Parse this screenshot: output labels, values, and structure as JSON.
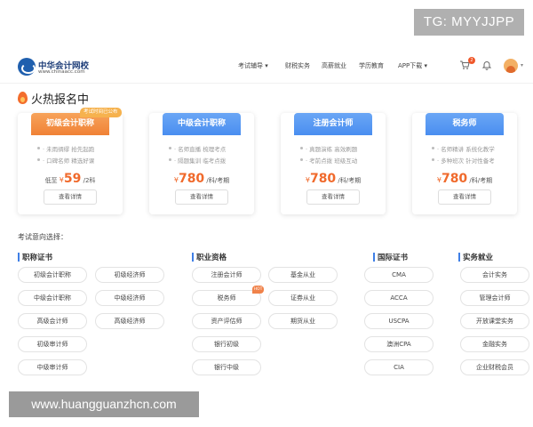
{
  "overlay": {
    "tg": "TG: MYYJJPP",
    "site": "www.huangguanzhcn.com"
  },
  "header": {
    "logo_name": "中华会计网校",
    "logo_url": "www.chinaacc.com",
    "nav": [
      "考试辅导",
      "财税实务",
      "高薪就业",
      "学历教育",
      "APP下载"
    ],
    "cart_count": "2"
  },
  "section": {
    "title": "火热报名中"
  },
  "cards": [
    {
      "title": "初级会计职称",
      "tag": "考试时间已公布",
      "features": [
        "· 未雨绸缪 抢先起跑",
        "· 口碑名师 精选好课"
      ],
      "price_prefix": "低至",
      "price_yen": "¥",
      "price": "59",
      "price_unit": "/2科",
      "button": "查看详情"
    },
    {
      "title": "中级会计职称",
      "features": [
        "· 名师直播 梳理考点",
        "· 隔题集训 临考点拨"
      ],
      "price_prefix": "",
      "price_yen": "¥",
      "price": "780",
      "price_unit": "/科/考期",
      "button": "查看详情"
    },
    {
      "title": "注册会计师",
      "features": [
        "· 真题演练 高效刷题",
        "· 考前点拨 班级互动"
      ],
      "price_prefix": "",
      "price_yen": "¥",
      "price": "780",
      "price_unit": "/科/考期",
      "button": "查看详情"
    },
    {
      "title": "税务师",
      "features": [
        "· 名师精讲 系统化教学",
        "· 多种班次 针对性备考"
      ],
      "price_prefix": "",
      "price_yen": "¥",
      "price": "780",
      "price_unit": "/科/考期",
      "button": "查看详情"
    }
  ],
  "intent": {
    "label": "考试意向选择：",
    "categories": [
      {
        "title": "职称证书",
        "items": [
          "初级会计职称",
          "初级经济师",
          "中级会计职称",
          "中级经济师",
          "高级会计师",
          "高级经济师",
          "初级审计师",
          "中级审计师"
        ]
      },
      {
        "title": "职业资格",
        "items": [
          "注册会计师",
          "基金从业",
          "税务师",
          "证券从业",
          "资产评估师",
          "期货从业",
          "银行初级",
          "银行中级"
        ],
        "hot_badge": "HOT"
      },
      {
        "title": "国际证书",
        "items": [
          "CMA",
          "ACCA",
          "USCPA",
          "澳洲CPA",
          "CIA"
        ]
      },
      {
        "title": "实务就业",
        "items": [
          "会计实务",
          "管理会计师",
          "开放课堂实务",
          "金融实务",
          "企业财税会员"
        ]
      }
    ]
  }
}
